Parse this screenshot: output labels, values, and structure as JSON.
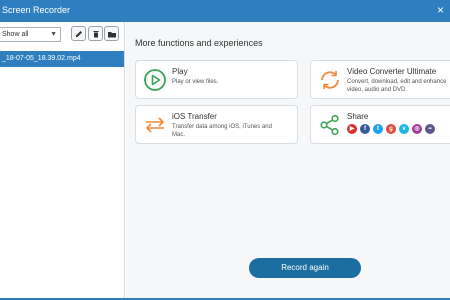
{
  "window": {
    "title": "Screen Recorder",
    "close_glyph": "×"
  },
  "sidebar": {
    "filter": {
      "selected": "Show all",
      "options": [
        "Show all"
      ]
    },
    "buttons": [
      {
        "icon": "edit-icon"
      },
      {
        "icon": "delete-icon"
      },
      {
        "icon": "folder-icon"
      }
    ],
    "files": [
      {
        "name": "_18-07-05_18.39.02.mp4",
        "selected": true
      }
    ]
  },
  "main": {
    "section_title": "More functions and experiences",
    "cards": {
      "play": {
        "title": "Play",
        "desc": "Play or view files.",
        "icon": "play-icon"
      },
      "converter": {
        "title": "Video Converter Ultimate",
        "desc": "Convert, download, edit and enhance\nvideo, audio and DVD.",
        "icon": "convert-icon"
      },
      "ios": {
        "title": "iOS Transfer",
        "desc": "Transfer data among iOS, iTunes and\nMac.",
        "icon": "transfer-icon"
      },
      "share": {
        "title": "Share",
        "icon": "share-icon",
        "networks": [
          {
            "name": "youtube",
            "glyph": "▶",
            "color": "#d9302c"
          },
          {
            "name": "facebook",
            "glyph": "f",
            "color": "#3b5998"
          },
          {
            "name": "twitter",
            "glyph": "t",
            "color": "#1da1f2"
          },
          {
            "name": "google-plus",
            "glyph": "g",
            "color": "#dd4b39"
          },
          {
            "name": "vimeo",
            "glyph": "v",
            "color": "#1ab7ea"
          },
          {
            "name": "instagram",
            "glyph": "◎",
            "color": "#a33aa0"
          },
          {
            "name": "flickr",
            "glyph": "••",
            "color": "#5a5a8a"
          }
        ]
      }
    },
    "record_button": "Record again"
  },
  "colors": {
    "accent": "#2f7fc0",
    "button": "#1c6ea1",
    "play": "#3aa655",
    "orange": "#f08a3c"
  }
}
